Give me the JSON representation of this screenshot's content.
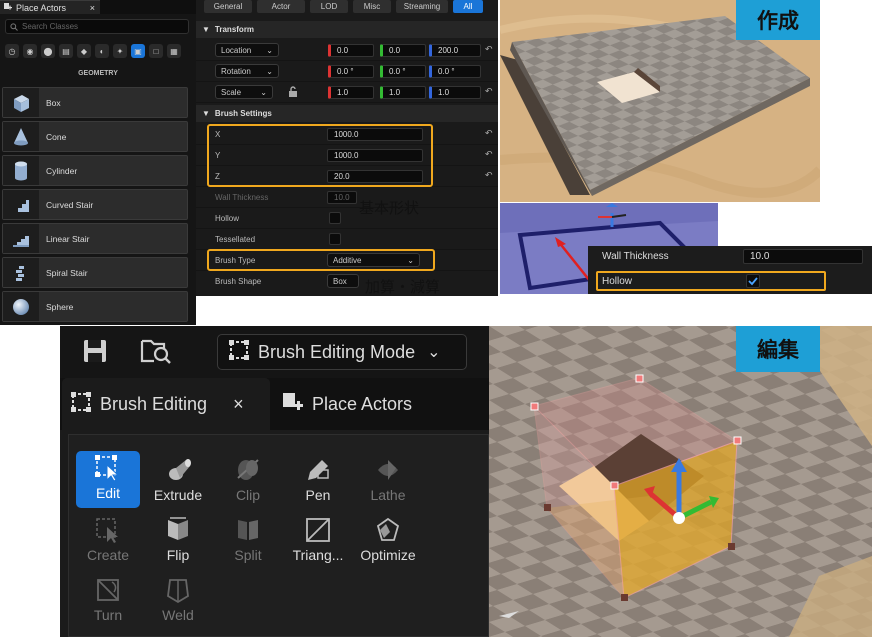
{
  "place_actors": {
    "tab_title": "Place Actors",
    "close_glyph": "×",
    "search_placeholder": "Search Classes",
    "category_icons": [
      "clock-icon",
      "light-bulb-icon",
      "pin-icon",
      "film-icon",
      "cube-filled-icon",
      "shape-icon",
      "sparkle-icon",
      "geometry-icon",
      "box-outline-icon",
      "stack-icon"
    ],
    "section_label": "GEOMETRY",
    "items": [
      {
        "label": "Box",
        "icon": "box-icon"
      },
      {
        "label": "Cone",
        "icon": "cone-icon"
      },
      {
        "label": "Cylinder",
        "icon": "cylinder-icon"
      },
      {
        "label": "Curved Stair",
        "icon": "curved-stair-icon"
      },
      {
        "label": "Linear Stair",
        "icon": "linear-stair-icon"
      },
      {
        "label": "Spiral Stair",
        "icon": "spiral-stair-icon"
      },
      {
        "label": "Sphere",
        "icon": "sphere-icon"
      }
    ]
  },
  "details": {
    "filter_tabs": [
      "General",
      "Actor",
      "LOD",
      "Misc",
      "Streaming",
      "All"
    ],
    "active_filter": "All",
    "transform": {
      "section": "Transform",
      "rows": [
        {
          "label": "Location",
          "x": "0.0",
          "y": "0.0",
          "z": "200.0"
        },
        {
          "label": "Rotation",
          "x": "0.0 °",
          "y": "0.0 °",
          "z": "0.0 °"
        },
        {
          "label": "Scale",
          "x": "1.0",
          "y": "1.0",
          "z": "1.0"
        }
      ],
      "reset_glyph": "↶"
    },
    "brush_settings": {
      "section": "Brush Settings",
      "x_label": "X",
      "x_value": "1000.0",
      "y_label": "Y",
      "y_value": "1000.0",
      "z_label": "Z",
      "z_value": "20.0",
      "wall_thickness_label": "Wall Thickness",
      "wall_thickness_value": "10.0",
      "hollow_label": "Hollow",
      "tessellated_label": "Tessellated",
      "brush_type_label": "Brush Type",
      "brush_type_value": "Additive",
      "brush_shape_label": "Brush Shape",
      "brush_shape_value": "Box"
    }
  },
  "annotations": {
    "basic_shape": "基本形状",
    "add_subtract": "加算・減算",
    "create_badge": "作成",
    "edit_badge": "編集"
  },
  "hollow_popup": {
    "wall_thickness_label": "Wall Thickness",
    "wall_thickness_value": "10.0",
    "hollow_label": "Hollow",
    "hollow_checked": true
  },
  "editor": {
    "mode_label": "Brush Editing Mode",
    "tabs": [
      {
        "label": "Brush Editing",
        "close": "×"
      },
      {
        "label": "Place Actors"
      }
    ],
    "tools": [
      {
        "label": "Edit",
        "enabled": true,
        "active": true
      },
      {
        "label": "Extrude",
        "enabled": true
      },
      {
        "label": "Clip",
        "enabled": false
      },
      {
        "label": "Pen",
        "enabled": true
      },
      {
        "label": "Lathe",
        "enabled": false
      },
      {
        "label": "Create",
        "enabled": false
      },
      {
        "label": "Flip",
        "enabled": true
      },
      {
        "label": "Split",
        "enabled": false
      },
      {
        "label": "Triang...",
        "enabled": true
      },
      {
        "label": "Optimize",
        "enabled": true
      },
      {
        "label": "Turn",
        "enabled": false
      },
      {
        "label": "Weld",
        "enabled": false
      }
    ]
  },
  "colors": {
    "accent_blue": "#1a75d8",
    "highlight_orange": "#f0a81e",
    "badge_blue": "#1e9fd6",
    "arrow_red": "#e02020"
  }
}
